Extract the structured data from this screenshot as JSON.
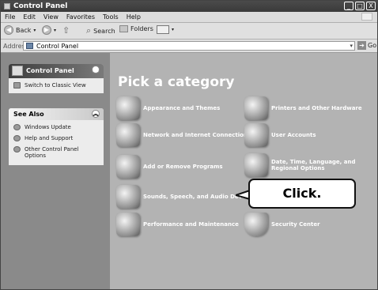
{
  "window": {
    "title": "Control Panel",
    "buttons": [
      "_",
      "□",
      "X"
    ]
  },
  "menu": [
    "File",
    "Edit",
    "View",
    "Favorites",
    "Tools",
    "Help"
  ],
  "toolbar": {
    "back": "Back",
    "search": "Search",
    "folders": "Folders"
  },
  "address": {
    "label": "Address",
    "value": "Control Panel",
    "go": "Go"
  },
  "sidebar": {
    "control_panel": {
      "title": "Control Panel",
      "switch": "Switch to Classic View"
    },
    "see_also": {
      "title": "See Also",
      "items": [
        "Windows Update",
        "Help and Support",
        "Other Control Panel Options"
      ]
    }
  },
  "main": {
    "heading": "Pick a category",
    "categories": [
      "Appearance and Themes",
      "Printers and Other Hardware",
      "Network and Internet Connections",
      "User Accounts",
      "Add or Remove Programs",
      "Date, Time, Language, and Regional Options",
      "Sounds, Speech, and Audio Devices",
      "Performance and Maintenance",
      "Security Center"
    ]
  },
  "callout": {
    "text": "Click."
  }
}
